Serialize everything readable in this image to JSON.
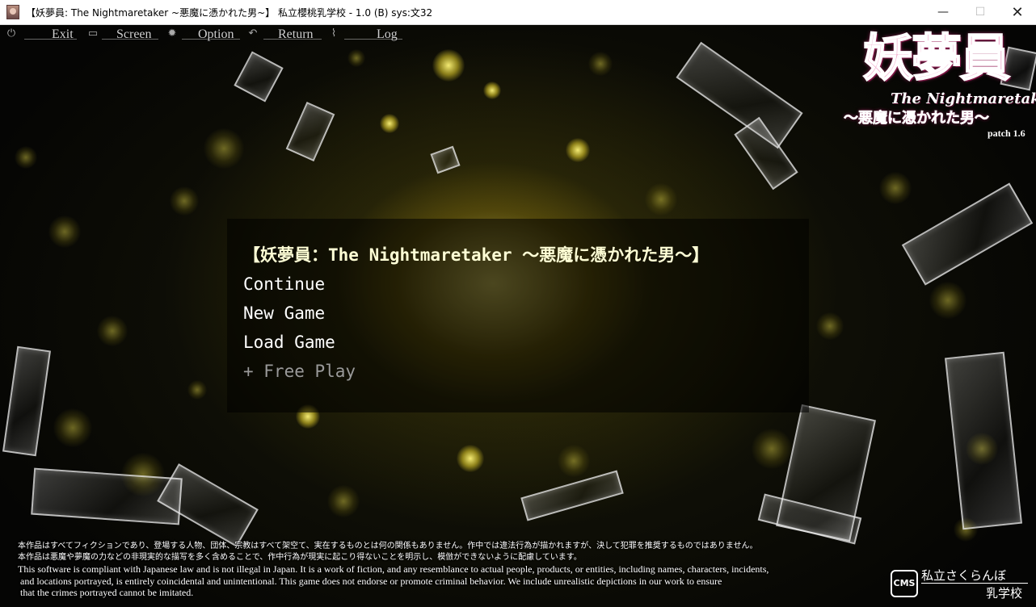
{
  "window": {
    "title": "【妖夢員: The Nightmaretaker ~悪魔に憑かれた男~】 私立櫻桃乳学校 - 1.0 (B) sys:文32",
    "minimize": "—",
    "maximize": "☐",
    "close": "✕"
  },
  "quick_menu": {
    "exit": "Exit",
    "screen": "Screen",
    "option": "Option",
    "return": "Return",
    "log": "Log"
  },
  "logo": {
    "kanji": "妖夢員",
    "english": "The Nightmaretaker",
    "subtitle": "〜悪魔に憑かれた男〜",
    "patch": "patch 1.6"
  },
  "main_menu": {
    "title": "【妖夢員：The Nightmaretaker 〜悪魔に憑かれた男〜】",
    "items": [
      {
        "label": "Continue"
      },
      {
        "label": "New Game"
      },
      {
        "label": "Load Game"
      },
      {
        "label": "+ Free Play"
      }
    ]
  },
  "disclaimer": {
    "jp_line1": "本作品はすべてフィクションであり、登場する人物、団体、宗教はすべて架空て、実在するものとは何の関係もありません。作中では違法行為が描かれますが、決して犯罪を推奨するものではありません。",
    "jp_line2": "本作品は悪魔や夢魔の力などの非現実的な描写を多く含めることで、作中行為が現実に起こり得ないことを明示し、模倣ができないように配慮しています。",
    "en_line1": "This software is compliant with Japanese law and is not illegal in Japan. It is a work of fiction, and any resemblance to actual people, products, or entities, including names, characters, incidents,",
    "en_line2": " and locations portrayed, is entirely coincidental and unintentional. This game does not endorse or promote criminal behavior. We include unrealistic depictions in our work to ensure",
    "en_line3": " that the crimes portrayed cannot be imitated."
  },
  "studio": {
    "mark": "CMS",
    "name_line1": "私立さくらんぼ",
    "name_line2": "乳学校"
  }
}
